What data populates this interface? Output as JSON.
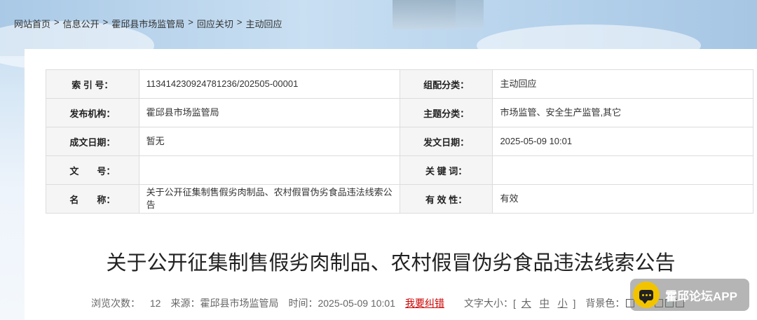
{
  "breadcrumb": {
    "items": [
      "网站首页",
      "信息公开",
      "霍邱县市场监管局",
      "回应关切",
      "主动回应"
    ],
    "sep": ">"
  },
  "meta": {
    "rows": [
      {
        "k1": "索 引 号：",
        "v1": "113414230924781236/202505-00001",
        "k2": "组配分类：",
        "v2": "主动回应"
      },
      {
        "k1": "发布机构：",
        "v1": "霍邱县市场监管局",
        "k2": "主题分类：",
        "v2": "市场监管、安全生产监管,其它"
      },
      {
        "k1": "成文日期：",
        "v1": "暂无",
        "k2": "发文日期：",
        "v2": "2025-05-09 10:01"
      },
      {
        "k1": "文　　号：",
        "v1": "",
        "k2": "关 键 词：",
        "v2": ""
      },
      {
        "k1": "名　　称：",
        "v1": "关于公开征集制售假劣肉制品、农村假冒伪劣食品违法线索公告",
        "k2": "有 效 性：",
        "v2": "有效"
      }
    ]
  },
  "article": {
    "title": "关于公开征集制售假劣肉制品、农村假冒伪劣食品违法线索公告",
    "views_label": "浏览次数：",
    "views": "12",
    "source_label": "来源：霍邱县市场监管局",
    "time_label": "时间：2025-05-09 10:01",
    "report": "我要纠错",
    "fontsize_label": "文字大小：[",
    "fontsize_large": "大",
    "fontsize_medium": "中",
    "fontsize_small": "小",
    "fontsize_end": "]",
    "bg_label": "背景色："
  },
  "badge": {
    "text": "霍邱论坛APP",
    "icon": "chat-bubble-icon",
    "color": "#f2c400"
  }
}
